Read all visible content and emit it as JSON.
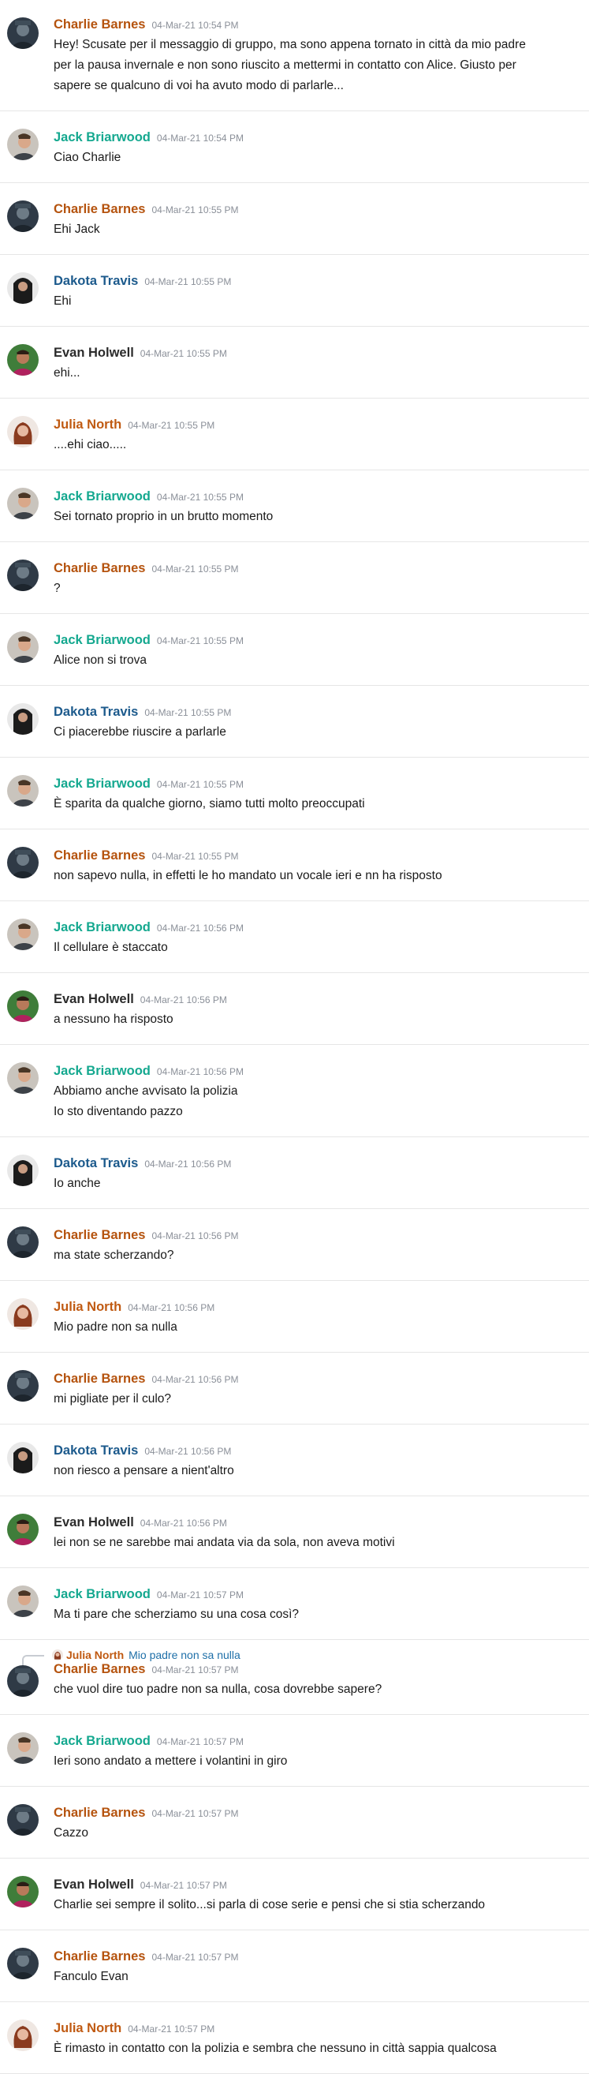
{
  "users": {
    "charlie": {
      "name": "Charlie Barnes",
      "color": "#b5530e",
      "avatar": "charlie-avatar-icon"
    },
    "jack": {
      "name": "Jack Briarwood",
      "color": "#14a88f",
      "avatar": "jack-avatar-icon"
    },
    "dakota": {
      "name": "Dakota Travis",
      "color": "#1c5a8c",
      "avatar": "dakota-avatar-icon"
    },
    "evan": {
      "name": "Evan Holwell",
      "color": "#2b2b2b",
      "avatar": "evan-avatar-icon"
    },
    "julia": {
      "name": "Julia North",
      "color": "#c05a12",
      "avatar": "julia-avatar-icon"
    }
  },
  "messages": [
    {
      "user": "charlie",
      "time": "04-Mar-21 10:54 PM",
      "lines": [
        "Hey! Scusate per il messaggio di gruppo, ma sono appena tornato in città da mio padre",
        "per la pausa invernale e non sono riuscito a mettermi in contatto con Alice. Giusto per",
        "sapere se qualcuno di voi ha avuto modo di parlarle..."
      ]
    },
    {
      "user": "jack",
      "time": "04-Mar-21 10:54 PM",
      "lines": [
        "Ciao Charlie"
      ]
    },
    {
      "user": "charlie",
      "time": "04-Mar-21 10:55 PM",
      "lines": [
        "Ehi Jack"
      ]
    },
    {
      "user": "dakota",
      "time": "04-Mar-21 10:55 PM",
      "lines": [
        "Ehi"
      ]
    },
    {
      "user": "evan",
      "time": "04-Mar-21 10:55 PM",
      "lines": [
        "ehi..."
      ]
    },
    {
      "user": "julia",
      "time": "04-Mar-21 10:55 PM",
      "lines": [
        "....ehi ciao....."
      ]
    },
    {
      "user": "jack",
      "time": "04-Mar-21 10:55 PM",
      "lines": [
        "Sei tornato proprio in un brutto momento"
      ]
    },
    {
      "user": "charlie",
      "time": "04-Mar-21 10:55 PM",
      "lines": [
        "?"
      ]
    },
    {
      "user": "jack",
      "time": "04-Mar-21 10:55 PM",
      "lines": [
        "Alice non si trova"
      ]
    },
    {
      "user": "dakota",
      "time": "04-Mar-21 10:55 PM",
      "lines": [
        "Ci piacerebbe riuscire a parlarle"
      ]
    },
    {
      "user": "jack",
      "time": "04-Mar-21 10:55 PM",
      "lines": [
        "È sparita da qualche giorno, siamo tutti molto preoccupati"
      ]
    },
    {
      "user": "charlie",
      "time": "04-Mar-21 10:55 PM",
      "lines": [
        "non sapevo nulla, in effetti le ho mandato un vocale ieri e nn ha risposto"
      ]
    },
    {
      "user": "jack",
      "time": "04-Mar-21 10:56 PM",
      "lines": [
        "Il cellulare è staccato"
      ]
    },
    {
      "user": "evan",
      "time": "04-Mar-21 10:56 PM",
      "lines": [
        "a nessuno ha risposto"
      ]
    },
    {
      "user": "jack",
      "time": "04-Mar-21 10:56 PM",
      "lines": [
        "Abbiamo anche avvisato la polizia",
        "Io sto diventando pazzo"
      ]
    },
    {
      "user": "dakota",
      "time": "04-Mar-21 10:56 PM",
      "lines": [
        "Io anche"
      ]
    },
    {
      "user": "charlie",
      "time": "04-Mar-21 10:56 PM",
      "lines": [
        "ma state scherzando?"
      ]
    },
    {
      "user": "julia",
      "time": "04-Mar-21 10:56 PM",
      "lines": [
        "Mio padre non sa nulla"
      ]
    },
    {
      "user": "charlie",
      "time": "04-Mar-21 10:56 PM",
      "lines": [
        "mi pigliate per il culo?"
      ]
    },
    {
      "user": "dakota",
      "time": "04-Mar-21 10:56 PM",
      "lines": [
        "non riesco a pensare a nient'altro"
      ]
    },
    {
      "user": "evan",
      "time": "04-Mar-21 10:56 PM",
      "lines": [
        "lei non se ne sarebbe mai andata via da sola, non aveva motivi"
      ]
    },
    {
      "user": "jack",
      "time": "04-Mar-21 10:57 PM",
      "lines": [
        "Ma ti pare che scherziamo su una cosa così?"
      ]
    },
    {
      "user": "charlie",
      "time": "04-Mar-21 10:57 PM",
      "reply": {
        "user": "julia",
        "name": "Julia North",
        "text": "Mio padre non sa nulla"
      },
      "lines": [
        "che vuol dire tuo padre non sa nulla, cosa dovrebbe sapere?"
      ]
    },
    {
      "user": "jack",
      "time": "04-Mar-21 10:57 PM",
      "lines": [
        "Ieri sono andato a mettere i volantini in giro"
      ]
    },
    {
      "user": "charlie",
      "time": "04-Mar-21 10:57 PM",
      "lines": [
        "Cazzo"
      ]
    },
    {
      "user": "evan",
      "time": "04-Mar-21 10:57 PM",
      "lines": [
        "Charlie sei sempre il solito...si parla di cose serie e pensi che si stia scherzando"
      ]
    },
    {
      "user": "charlie",
      "time": "04-Mar-21 10:57 PM",
      "lines": [
        "Fanculo Evan"
      ]
    },
    {
      "user": "julia",
      "time": "04-Mar-21 10:57 PM",
      "lines": [
        "È rimasto in contatto con la polizia e sembra che nessuno in città sappia qualcosa"
      ]
    }
  ]
}
